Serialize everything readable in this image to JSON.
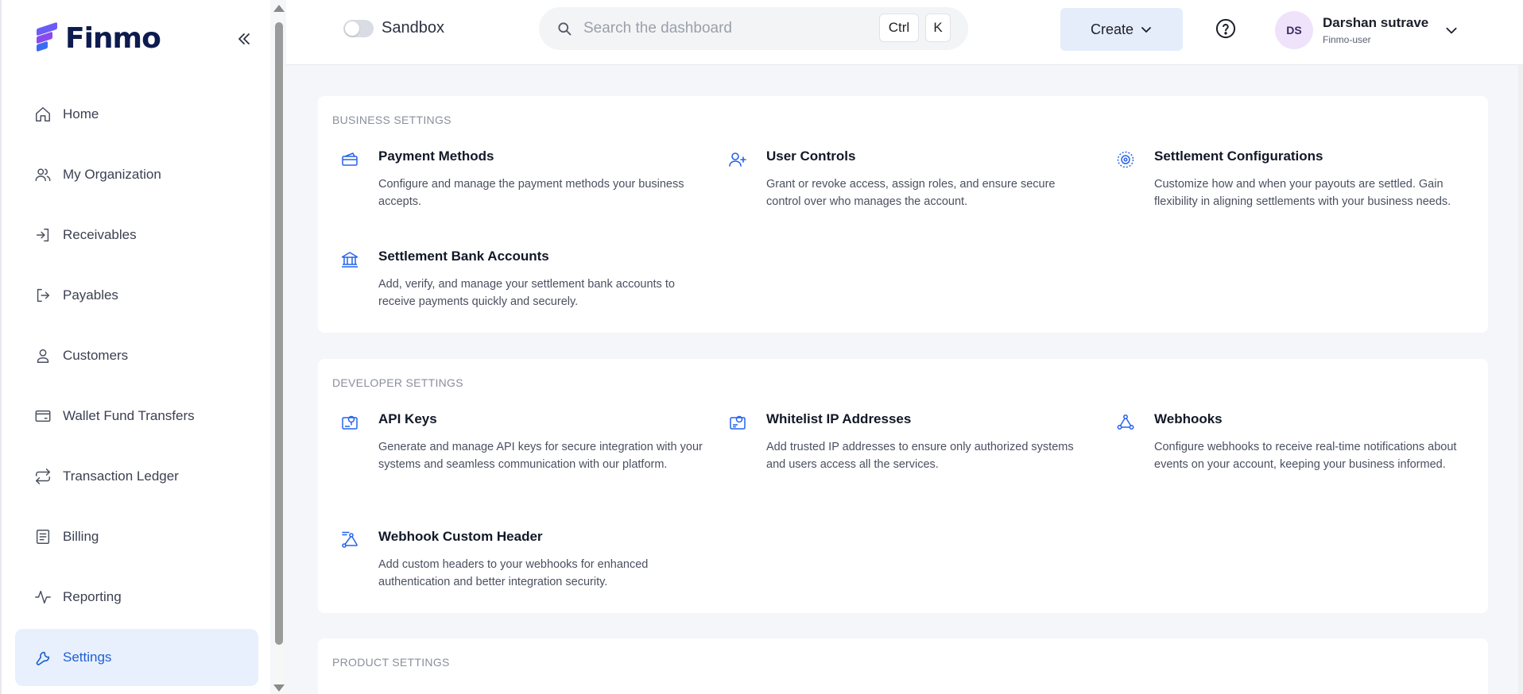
{
  "brand": {
    "name": "Finmo"
  },
  "sidebar": {
    "items": [
      {
        "label": "Home",
        "icon": "home-icon"
      },
      {
        "label": "My Organization",
        "icon": "users-icon"
      },
      {
        "label": "Receivables",
        "icon": "arrow-in-icon"
      },
      {
        "label": "Payables",
        "icon": "arrow-out-icon"
      },
      {
        "label": "Customers",
        "icon": "user-icon"
      },
      {
        "label": "Wallet Fund Transfers",
        "icon": "wallet-icon"
      },
      {
        "label": "Transaction Ledger",
        "icon": "repeat-icon"
      },
      {
        "label": "Billing",
        "icon": "receipt-icon"
      },
      {
        "label": "Reporting",
        "icon": "activity-icon"
      },
      {
        "label": "Settings",
        "icon": "wrench-icon",
        "active": true
      }
    ]
  },
  "topbar": {
    "sandbox_label": "Sandbox",
    "search_placeholder": "Search the dashboard",
    "shortcut_ctrl": "Ctrl",
    "shortcut_k": "K",
    "create_label": "Create",
    "user": {
      "initials": "DS",
      "name": "Darshan sutrave",
      "role": "Finmo-user"
    }
  },
  "sections": [
    {
      "title": "BUSINESS SETTINGS",
      "items": [
        {
          "title": "Payment Methods",
          "desc": "Configure and manage the payment methods your business accepts.",
          "icon": "card-icon"
        },
        {
          "title": "User Controls",
          "desc": "Grant or revoke access, assign roles, and ensure secure control over who manages the account.",
          "icon": "user-plus-icon"
        },
        {
          "title": "Settlement Configurations",
          "desc": "Customize how and when your payouts are settled. Gain flexibility in aligning settlements with your business needs.",
          "icon": "gear-icon"
        },
        {
          "title": "Settlement Bank Accounts",
          "desc": "Add, verify, and manage your settlement bank accounts to receive payments quickly and securely.",
          "icon": "bank-icon"
        }
      ]
    },
    {
      "title": "DEVELOPER SETTINGS",
      "items": [
        {
          "title": "API Keys",
          "desc": "Generate and manage API keys for secure integration with your systems and seamless communication with our platform.",
          "icon": "key-card-icon"
        },
        {
          "title": "Whitelist IP Addresses",
          "desc": "Add trusted IP addresses to ensure only authorized systems and users access all the services.",
          "icon": "ip-card-icon"
        },
        {
          "title": "Webhooks",
          "desc": "Configure webhooks to receive real-time notifications about events on your account, keeping your business informed.",
          "icon": "webhook-icon"
        },
        {
          "title": "Webhook Custom Header",
          "desc": "Add custom headers to your webhooks for enhanced authentication and better integration security.",
          "icon": "webhook-header-icon"
        }
      ]
    },
    {
      "title": "PRODUCT SETTINGS",
      "items": []
    }
  ],
  "colors": {
    "accent": "#1f5fd1",
    "active_bg": "#e8f0fd",
    "icon_blue": "#2563eb"
  }
}
